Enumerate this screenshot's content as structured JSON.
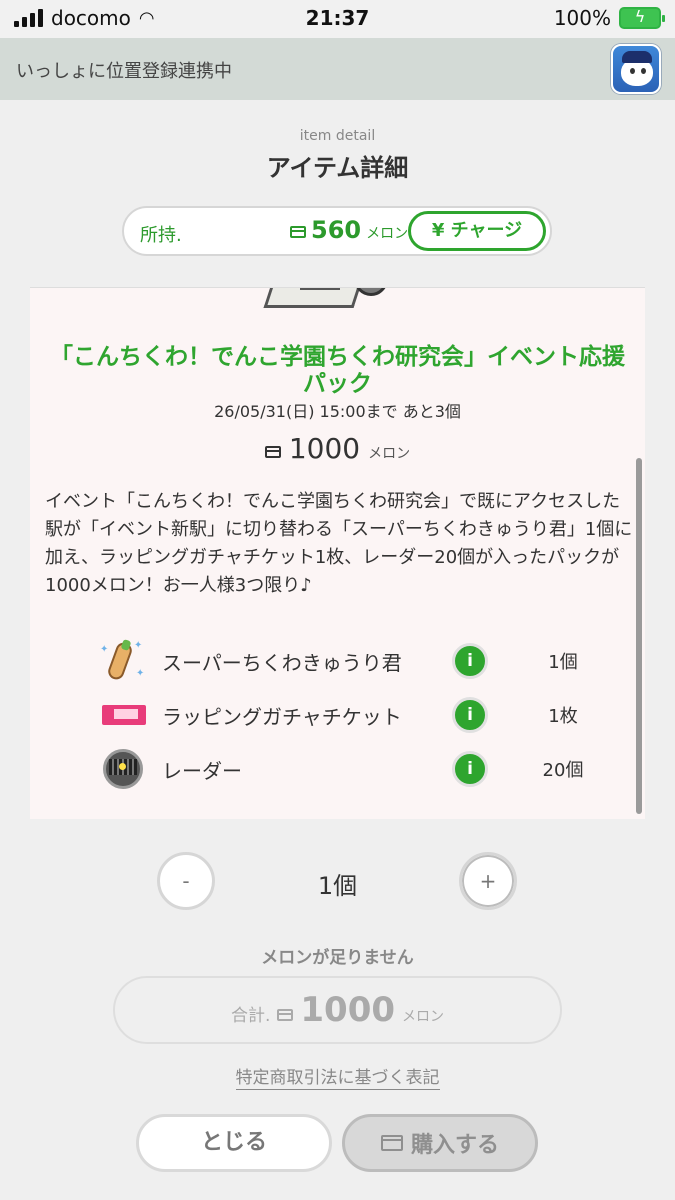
{
  "status_bar": {
    "carrier": "docomo",
    "time": "21:37",
    "battery": "100%"
  },
  "app_header": {
    "text": "いっしょに位置登録連携中"
  },
  "page": {
    "subtitle": "item detail",
    "title": "アイテム詳細"
  },
  "balance": {
    "label": "所持.",
    "amount": "560",
    "unit": "メロン",
    "charge_label": "¥ チャージ"
  },
  "item": {
    "title": "「こんちくわ！でんこ学園ちくわ研究会」イベント応援パック",
    "deadline": "26/05/31(日) 15:00まで あと3個",
    "price": "1000",
    "price_unit": "メロン",
    "description": "イベント「こんちくわ！でんこ学園ちくわ研究会」で既にアクセスした駅が「イベント新駅」に切り替わる「スーパーちくわきゅうり君」1個に加え、ラッピングガチャチケット1枚、レーダー20個が入ったパックが1000メロン！お一人様3つ限り♪",
    "contents": [
      {
        "name": "スーパーちくわきゅうり君",
        "qty": "1個",
        "icon": "cucumber-icon"
      },
      {
        "name": "ラッピングガチャチケット",
        "qty": "1枚",
        "icon": "ticket-icon"
      },
      {
        "name": "レーダー",
        "qty": "20個",
        "icon": "radar-icon"
      }
    ],
    "info_label": "i"
  },
  "quantity": {
    "minus": "-",
    "value": "1個",
    "plus": "+"
  },
  "purchase": {
    "warning": "メロンが足りません",
    "total_label": "合計.",
    "total_value": "1000",
    "total_unit": "メロン",
    "legal_link": "特定商取引法に基づく表記",
    "close_label": "とじる",
    "buy_label": "購入する"
  },
  "colors": {
    "accent_green": "#2ea52e",
    "header_bg": "#d3dad6",
    "card_bg": "#fcf5f5"
  }
}
